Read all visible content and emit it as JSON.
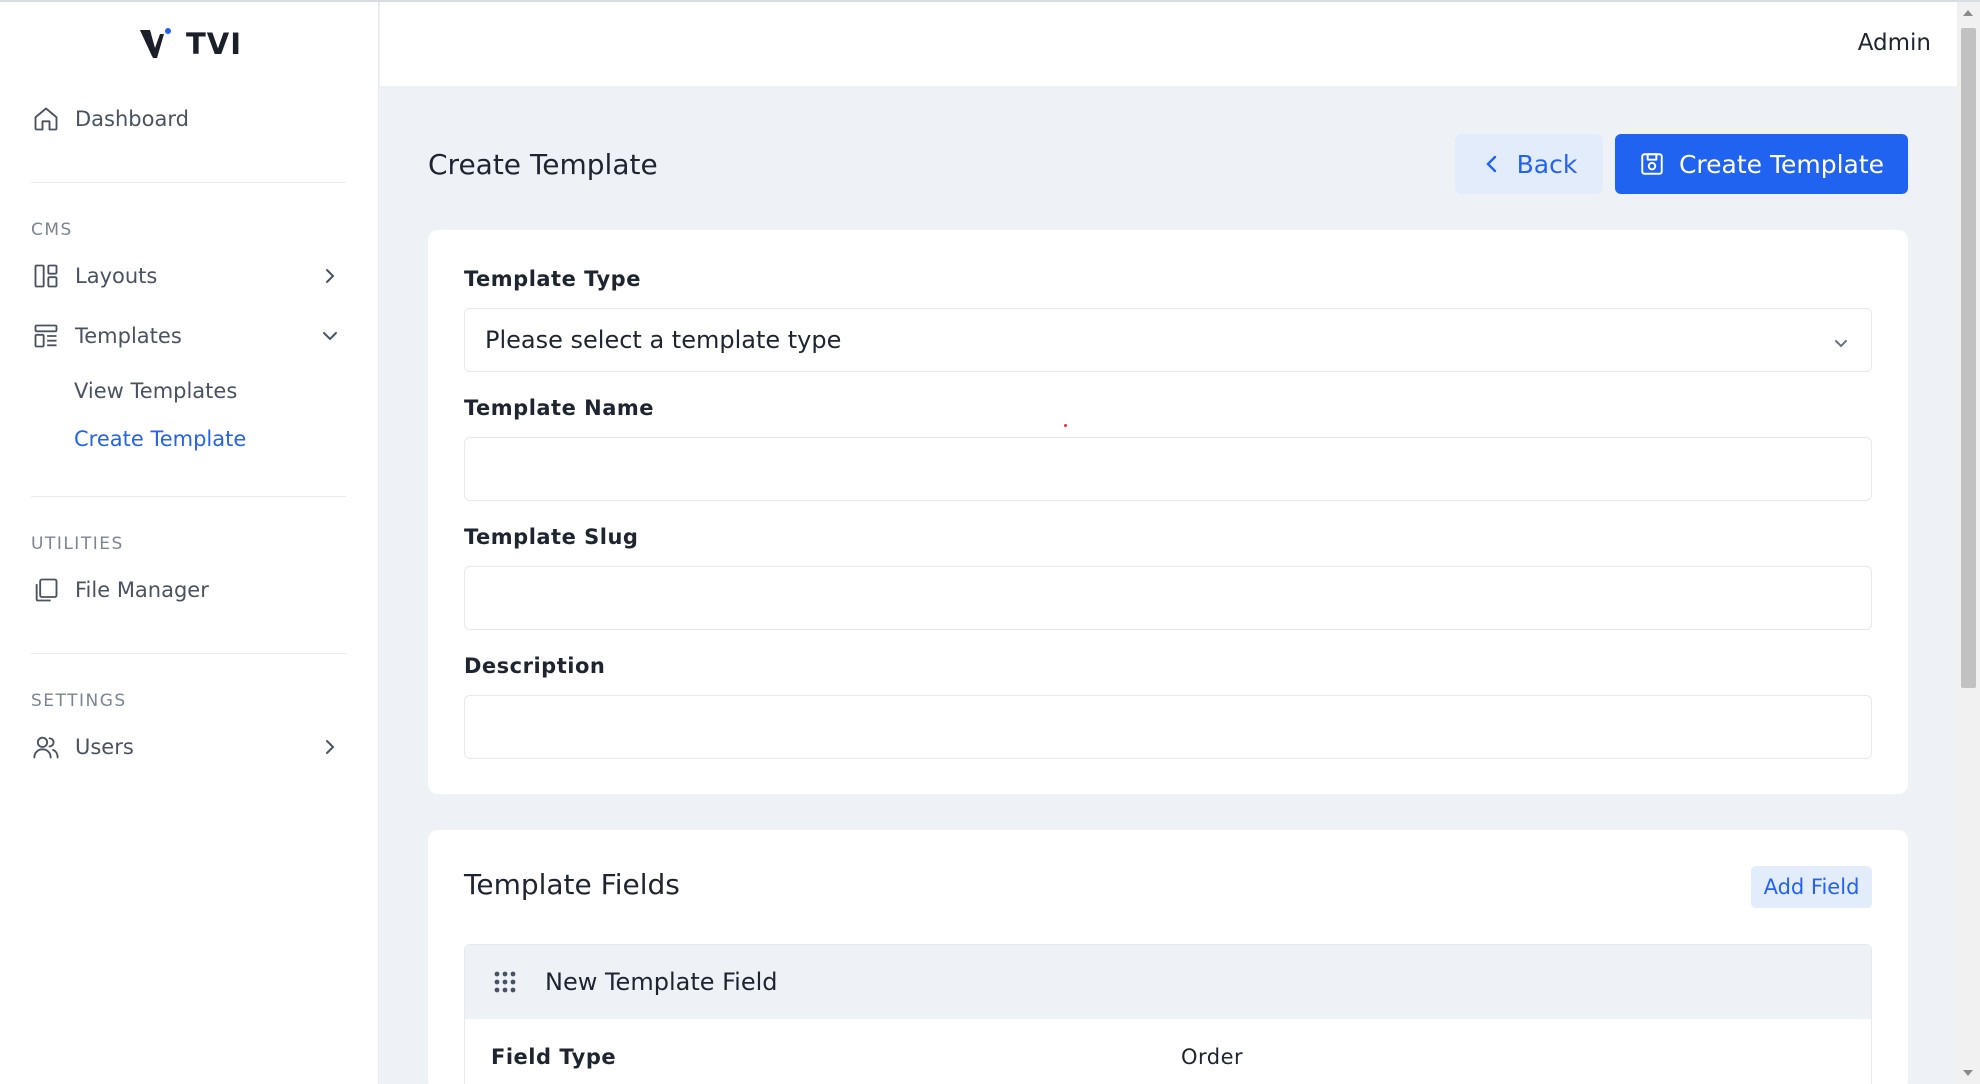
{
  "app": {
    "logo_text": "TVI"
  },
  "header": {
    "user": "Admin"
  },
  "sidebar": {
    "dashboard": "Dashboard",
    "sections": [
      {
        "label": "CMS"
      },
      {
        "label": "UTILITIES"
      },
      {
        "label": "SETTINGS"
      }
    ],
    "items": {
      "layouts": "Layouts",
      "templates": "Templates",
      "view_templates": "View Templates",
      "create_template": "Create Template",
      "file_manager": "File Manager",
      "users": "Users"
    }
  },
  "page": {
    "title": "Create Template",
    "back_label": "Back",
    "create_label": "Create Template"
  },
  "form": {
    "template_type": {
      "label": "Template Type",
      "value": "Please select a template type"
    },
    "template_name": {
      "label": "Template Name",
      "value": ""
    },
    "template_slug": {
      "label": "Template Slug",
      "value": ""
    },
    "description": {
      "label": "Description",
      "value": ""
    }
  },
  "fields_section": {
    "title": "Template Fields",
    "add_label": "Add Field",
    "panel": {
      "title": "New Template Field",
      "field_type_label": "Field Type",
      "order_label": "Order"
    }
  },
  "colors": {
    "accent": "#1f63f0",
    "accent_light": "#e3ecfb",
    "active_link": "#2463eb",
    "background": "#eef2f7"
  }
}
